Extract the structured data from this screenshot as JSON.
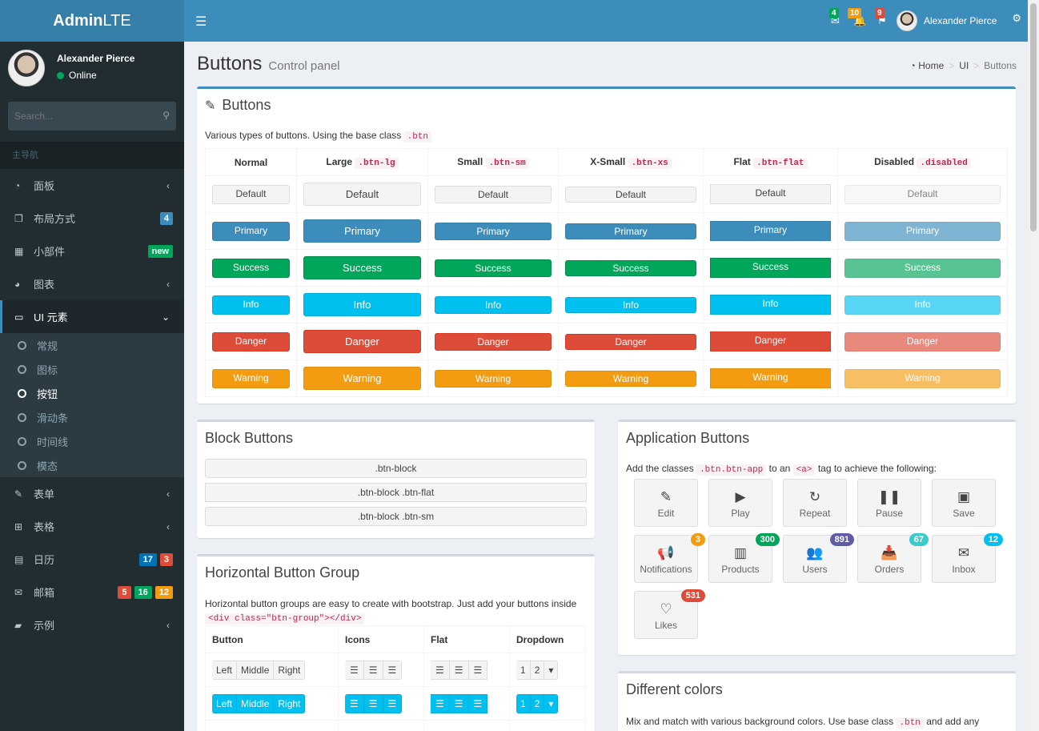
{
  "logo": {
    "bold": "Admin",
    "light": "LTE"
  },
  "topbar": {
    "toggle_icon": "☰",
    "messages_count": "4",
    "notifications_count": "10",
    "tasks_count": "9",
    "user_name": "Alexander Pierce",
    "badge_colors": {
      "messages": "#00a65a",
      "notifications": "#f39c12",
      "tasks": "#dd4b39"
    }
  },
  "sidebar": {
    "user_name": "Alexander Pierce",
    "status": "Online",
    "search_placeholder": "Search...",
    "header": "主导航",
    "items": [
      {
        "label": "面板",
        "icon": "dashboard-icon"
      },
      {
        "label": "布局方式",
        "icon": "files-icon",
        "badges": [
          "4"
        ]
      },
      {
        "label": "小部件",
        "icon": "th-icon",
        "badges": [
          "new"
        ]
      },
      {
        "label": "图表",
        "icon": "pie-chart-icon"
      },
      {
        "label": "UI 元素",
        "icon": "laptop-icon"
      },
      {
        "label": "表单",
        "icon": "edit-icon"
      },
      {
        "label": "表格",
        "icon": "table-icon"
      },
      {
        "label": "日历",
        "icon": "calendar-icon",
        "badges": [
          "17",
          "3"
        ]
      },
      {
        "label": "邮箱",
        "icon": "envelope-icon",
        "badges": [
          "5",
          "16",
          "12"
        ]
      },
      {
        "label": "示例",
        "icon": "folder-icon"
      }
    ],
    "sub_items": [
      "常规",
      "图标",
      "按钮",
      "滑动条",
      "时间线",
      "模态"
    ]
  },
  "page": {
    "title": "Buttons",
    "subtitle": "Control panel"
  },
  "breadcrumb": {
    "home": "Home",
    "ui": "UI",
    "current": "Buttons"
  },
  "buttons_box": {
    "title": "Buttons",
    "desc": "Various types of buttons. Using the base class",
    "desc_code": ".btn",
    "columns": [
      {
        "name": "Normal",
        "code": ""
      },
      {
        "name": "Large",
        "code": ".btn-lg"
      },
      {
        "name": "Small",
        "code": ".btn-sm"
      },
      {
        "name": "X-Small",
        "code": ".btn-xs"
      },
      {
        "name": "Flat",
        "code": ".btn-flat"
      },
      {
        "name": "Disabled",
        "code": ".disabled"
      }
    ],
    "rows": [
      "Default",
      "Primary",
      "Success",
      "Info",
      "Danger",
      "Warning"
    ]
  },
  "block_box": {
    "title": "Block Buttons",
    "buttons": [
      ".btn-block",
      ".btn-block .btn-flat",
      ".btn-block .btn-sm"
    ]
  },
  "hgroup_box": {
    "title": "Horizontal Button Group",
    "desc": "Horizontal button groups are easy to create with bootstrap. Just add your buttons inside",
    "desc_code": "<div class=\"btn-group\"></div>",
    "headers": [
      "Button",
      "Icons",
      "Flat",
      "Dropdown"
    ],
    "group_labels": [
      "Left",
      "Middle",
      "Right"
    ],
    "dropdown_labels": [
      "1",
      "2"
    ]
  },
  "app_box": {
    "title": "Application Buttons",
    "desc_pre": "Add the classes",
    "desc_code1": ".btn.btn-app",
    "desc_mid": "to an",
    "desc_code2": "<a>",
    "desc_post": "tag to achieve the following:",
    "apps": [
      {
        "label": "Edit",
        "icon": "edit-icon"
      },
      {
        "label": "Play",
        "icon": "play-icon"
      },
      {
        "label": "Repeat",
        "icon": "repeat-icon"
      },
      {
        "label": "Pause",
        "icon": "pause-icon"
      },
      {
        "label": "Save",
        "icon": "save-icon"
      },
      {
        "label": "Notifications",
        "icon": "bullhorn-icon",
        "badge": "3",
        "badge_color": "#f39c12"
      },
      {
        "label": "Products",
        "icon": "barcode-icon",
        "badge": "300",
        "badge_color": "#00a65a"
      },
      {
        "label": "Users",
        "icon": "users-icon",
        "badge": "891",
        "badge_color": "#605ca8"
      },
      {
        "label": "Orders",
        "icon": "inbox-icon",
        "badge": "67",
        "badge_color": "#39cccc"
      },
      {
        "label": "Inbox",
        "icon": "envelope-icon",
        "badge": "12",
        "badge_color": "#00c0ef"
      },
      {
        "label": "Likes",
        "icon": "heart-icon",
        "badge": "531",
        "badge_color": "#dd4b39"
      }
    ]
  },
  "colors_box": {
    "title": "Different colors",
    "desc": "Mix and match with various background colors. Use base class",
    "desc_code": ".btn",
    "desc_post": "and add any"
  }
}
